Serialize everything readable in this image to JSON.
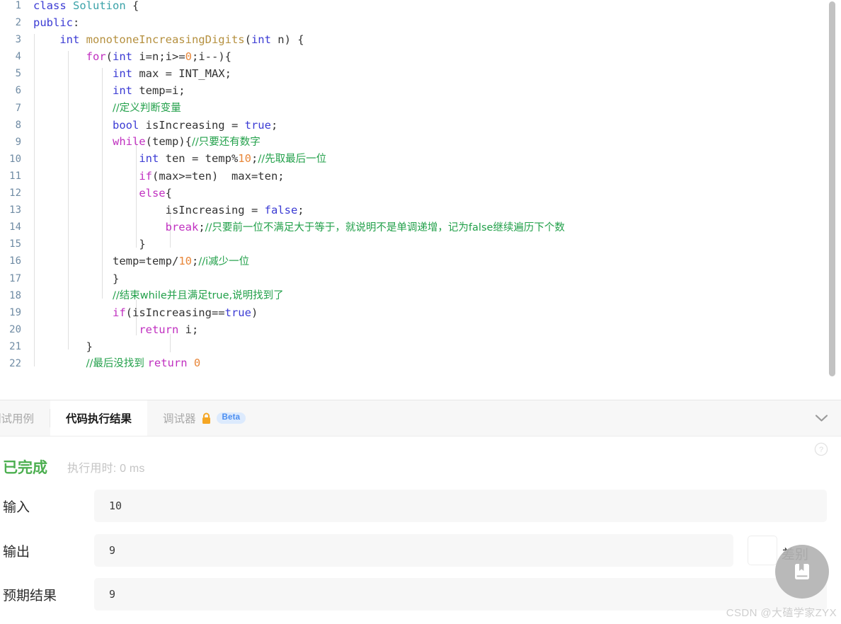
{
  "editor": {
    "language": "cpp",
    "lines": [
      {
        "num": "1",
        "tokens": [
          {
            "t": "class ",
            "c": "k"
          },
          {
            "t": "Solution ",
            "c": "ty"
          },
          {
            "t": "{",
            "c": "pl"
          }
        ]
      },
      {
        "num": "2",
        "tokens": [
          {
            "t": "public",
            "c": "k"
          },
          {
            "t": ":",
            "c": "pl"
          }
        ]
      },
      {
        "num": "3",
        "tokens": [
          {
            "t": "    ",
            "c": "pl"
          },
          {
            "t": "int ",
            "c": "k"
          },
          {
            "t": "monotoneIncreasingDigits",
            "c": "fn"
          },
          {
            "t": "(",
            "c": "pl"
          },
          {
            "t": "int",
            "c": "k"
          },
          {
            "t": " n) {",
            "c": "pl"
          }
        ]
      },
      {
        "num": "4",
        "tokens": [
          {
            "t": "        ",
            "c": "pl"
          },
          {
            "t": "for",
            "c": "kc"
          },
          {
            "t": "(",
            "c": "pl"
          },
          {
            "t": "int",
            "c": "k"
          },
          {
            "t": " i=n;i>=",
            "c": "pl"
          },
          {
            "t": "0",
            "c": "n"
          },
          {
            "t": ";i--){",
            "c": "pl"
          }
        ]
      },
      {
        "num": "5",
        "tokens": [
          {
            "t": "            ",
            "c": "pl"
          },
          {
            "t": "int",
            "c": "k"
          },
          {
            "t": " max = INT_MAX;",
            "c": "pl"
          }
        ]
      },
      {
        "num": "6",
        "tokens": [
          {
            "t": "            ",
            "c": "pl"
          },
          {
            "t": "int",
            "c": "k"
          },
          {
            "t": " temp=i;",
            "c": "pl"
          }
        ]
      },
      {
        "num": "7",
        "tokens": [
          {
            "t": "            ",
            "c": "pl"
          },
          {
            "t": "//定义判断变量",
            "c": "cm-cn"
          }
        ]
      },
      {
        "num": "8",
        "tokens": [
          {
            "t": "            ",
            "c": "pl"
          },
          {
            "t": "bool",
            "c": "k"
          },
          {
            "t": " isIncreasing = ",
            "c": "pl"
          },
          {
            "t": "true",
            "c": "k"
          },
          {
            "t": ";",
            "c": "pl"
          }
        ]
      },
      {
        "num": "9",
        "tokens": [
          {
            "t": "            ",
            "c": "pl"
          },
          {
            "t": "while",
            "c": "kc"
          },
          {
            "t": "(temp){",
            "c": "pl"
          },
          {
            "t": "//只要还有数字",
            "c": "cm-cn"
          }
        ]
      },
      {
        "num": "10",
        "tokens": [
          {
            "t": "                ",
            "c": "pl"
          },
          {
            "t": "int",
            "c": "k"
          },
          {
            "t": " ten = temp%",
            "c": "pl"
          },
          {
            "t": "10",
            "c": "n"
          },
          {
            "t": ";",
            "c": "pl"
          },
          {
            "t": "//先取最后一位",
            "c": "cm-cn"
          }
        ]
      },
      {
        "num": "11",
        "tokens": [
          {
            "t": "                ",
            "c": "pl"
          },
          {
            "t": "if",
            "c": "kc"
          },
          {
            "t": "(max>=ten)  max=ten;",
            "c": "pl"
          }
        ]
      },
      {
        "num": "12",
        "tokens": [
          {
            "t": "                ",
            "c": "pl"
          },
          {
            "t": "else",
            "c": "kc"
          },
          {
            "t": "{",
            "c": "pl"
          }
        ]
      },
      {
        "num": "13",
        "tokens": [
          {
            "t": "                    ",
            "c": "pl"
          },
          {
            "t": "isIncreasing = ",
            "c": "pl"
          },
          {
            "t": "false",
            "c": "k"
          },
          {
            "t": ";",
            "c": "pl"
          }
        ]
      },
      {
        "num": "14",
        "tokens": [
          {
            "t": "                    ",
            "c": "pl"
          },
          {
            "t": "break",
            "c": "kc"
          },
          {
            "t": ";",
            "c": "pl"
          },
          {
            "t": "//只要前一位不满足大于等于，就说明不是单调递增，记为false继续遍历下个数",
            "c": "cm-cn"
          }
        ]
      },
      {
        "num": "15",
        "tokens": [
          {
            "t": "                ",
            "c": "pl"
          },
          {
            "t": "}",
            "c": "pl"
          }
        ]
      },
      {
        "num": "16",
        "tokens": [
          {
            "t": "            ",
            "c": "pl"
          },
          {
            "t": "temp=temp/",
            "c": "pl"
          },
          {
            "t": "10",
            "c": "n"
          },
          {
            "t": ";",
            "c": "pl"
          },
          {
            "t": "//i减少一位",
            "c": "cm-cn"
          }
        ]
      },
      {
        "num": "17",
        "tokens": [
          {
            "t": "            ",
            "c": "pl"
          },
          {
            "t": "}",
            "c": "pl"
          }
        ]
      },
      {
        "num": "18",
        "tokens": [
          {
            "t": "            ",
            "c": "pl"
          },
          {
            "t": "//结束while并且满足true,说明找到了",
            "c": "cm-cn"
          }
        ]
      },
      {
        "num": "19",
        "tokens": [
          {
            "t": "            ",
            "c": "pl"
          },
          {
            "t": "if",
            "c": "kc"
          },
          {
            "t": "(isIncreasing==",
            "c": "pl"
          },
          {
            "t": "true",
            "c": "k"
          },
          {
            "t": ")",
            "c": "pl"
          }
        ]
      },
      {
        "num": "20",
        "tokens": [
          {
            "t": "                ",
            "c": "pl"
          },
          {
            "t": "return",
            "c": "kc"
          },
          {
            "t": " i;",
            "c": "pl"
          }
        ]
      },
      {
        "num": "21",
        "tokens": [
          {
            "t": "        ",
            "c": "pl"
          },
          {
            "t": "}",
            "c": "pl"
          }
        ]
      },
      {
        "num": "22",
        "tokens": [
          {
            "t": "        ",
            "c": "pl"
          },
          {
            "t": "//最后没找到 ",
            "c": "cm-cn"
          },
          {
            "t": "return",
            "c": "kc"
          },
          {
            "t": " ",
            "c": "pl"
          },
          {
            "t": "0",
            "c": "n"
          }
        ]
      }
    ]
  },
  "tabs": [
    {
      "id": "testcase",
      "label": "测试用例",
      "active": false,
      "lock": false,
      "badge": null
    },
    {
      "id": "result",
      "label": "代码执行结果",
      "active": true,
      "lock": false,
      "badge": null
    },
    {
      "id": "debugger",
      "label": "调试器",
      "active": false,
      "lock": true,
      "badge": "Beta"
    }
  ],
  "tabbar": {
    "collapse_icon": "chevron-down-icon"
  },
  "result": {
    "status": "已完成",
    "runtime_label": "执行用时:",
    "runtime_value": "0 ms",
    "help_icon": "question-circle-icon",
    "rows": [
      {
        "id": "input",
        "label": "输入",
        "value": "10"
      },
      {
        "id": "output",
        "label": "输出",
        "value": "9"
      },
      {
        "id": "expected",
        "label": "预期结果",
        "value": "9"
      }
    ],
    "diff_label": "差别",
    "diff_checked": false
  },
  "fab": {
    "icon": "book-icon"
  },
  "watermark": "CSDN @大磕学家ZYX",
  "colors": {
    "status_green": "#4caf50",
    "keyword_blue": "#3b3bd4",
    "control_magenta": "#c030c0",
    "comment_green": "#22a04a",
    "number_orange": "#e8873a",
    "function_gold": "#b5903f",
    "beta_blue": "#4b8ef0",
    "lock_orange": "#f5a623"
  }
}
